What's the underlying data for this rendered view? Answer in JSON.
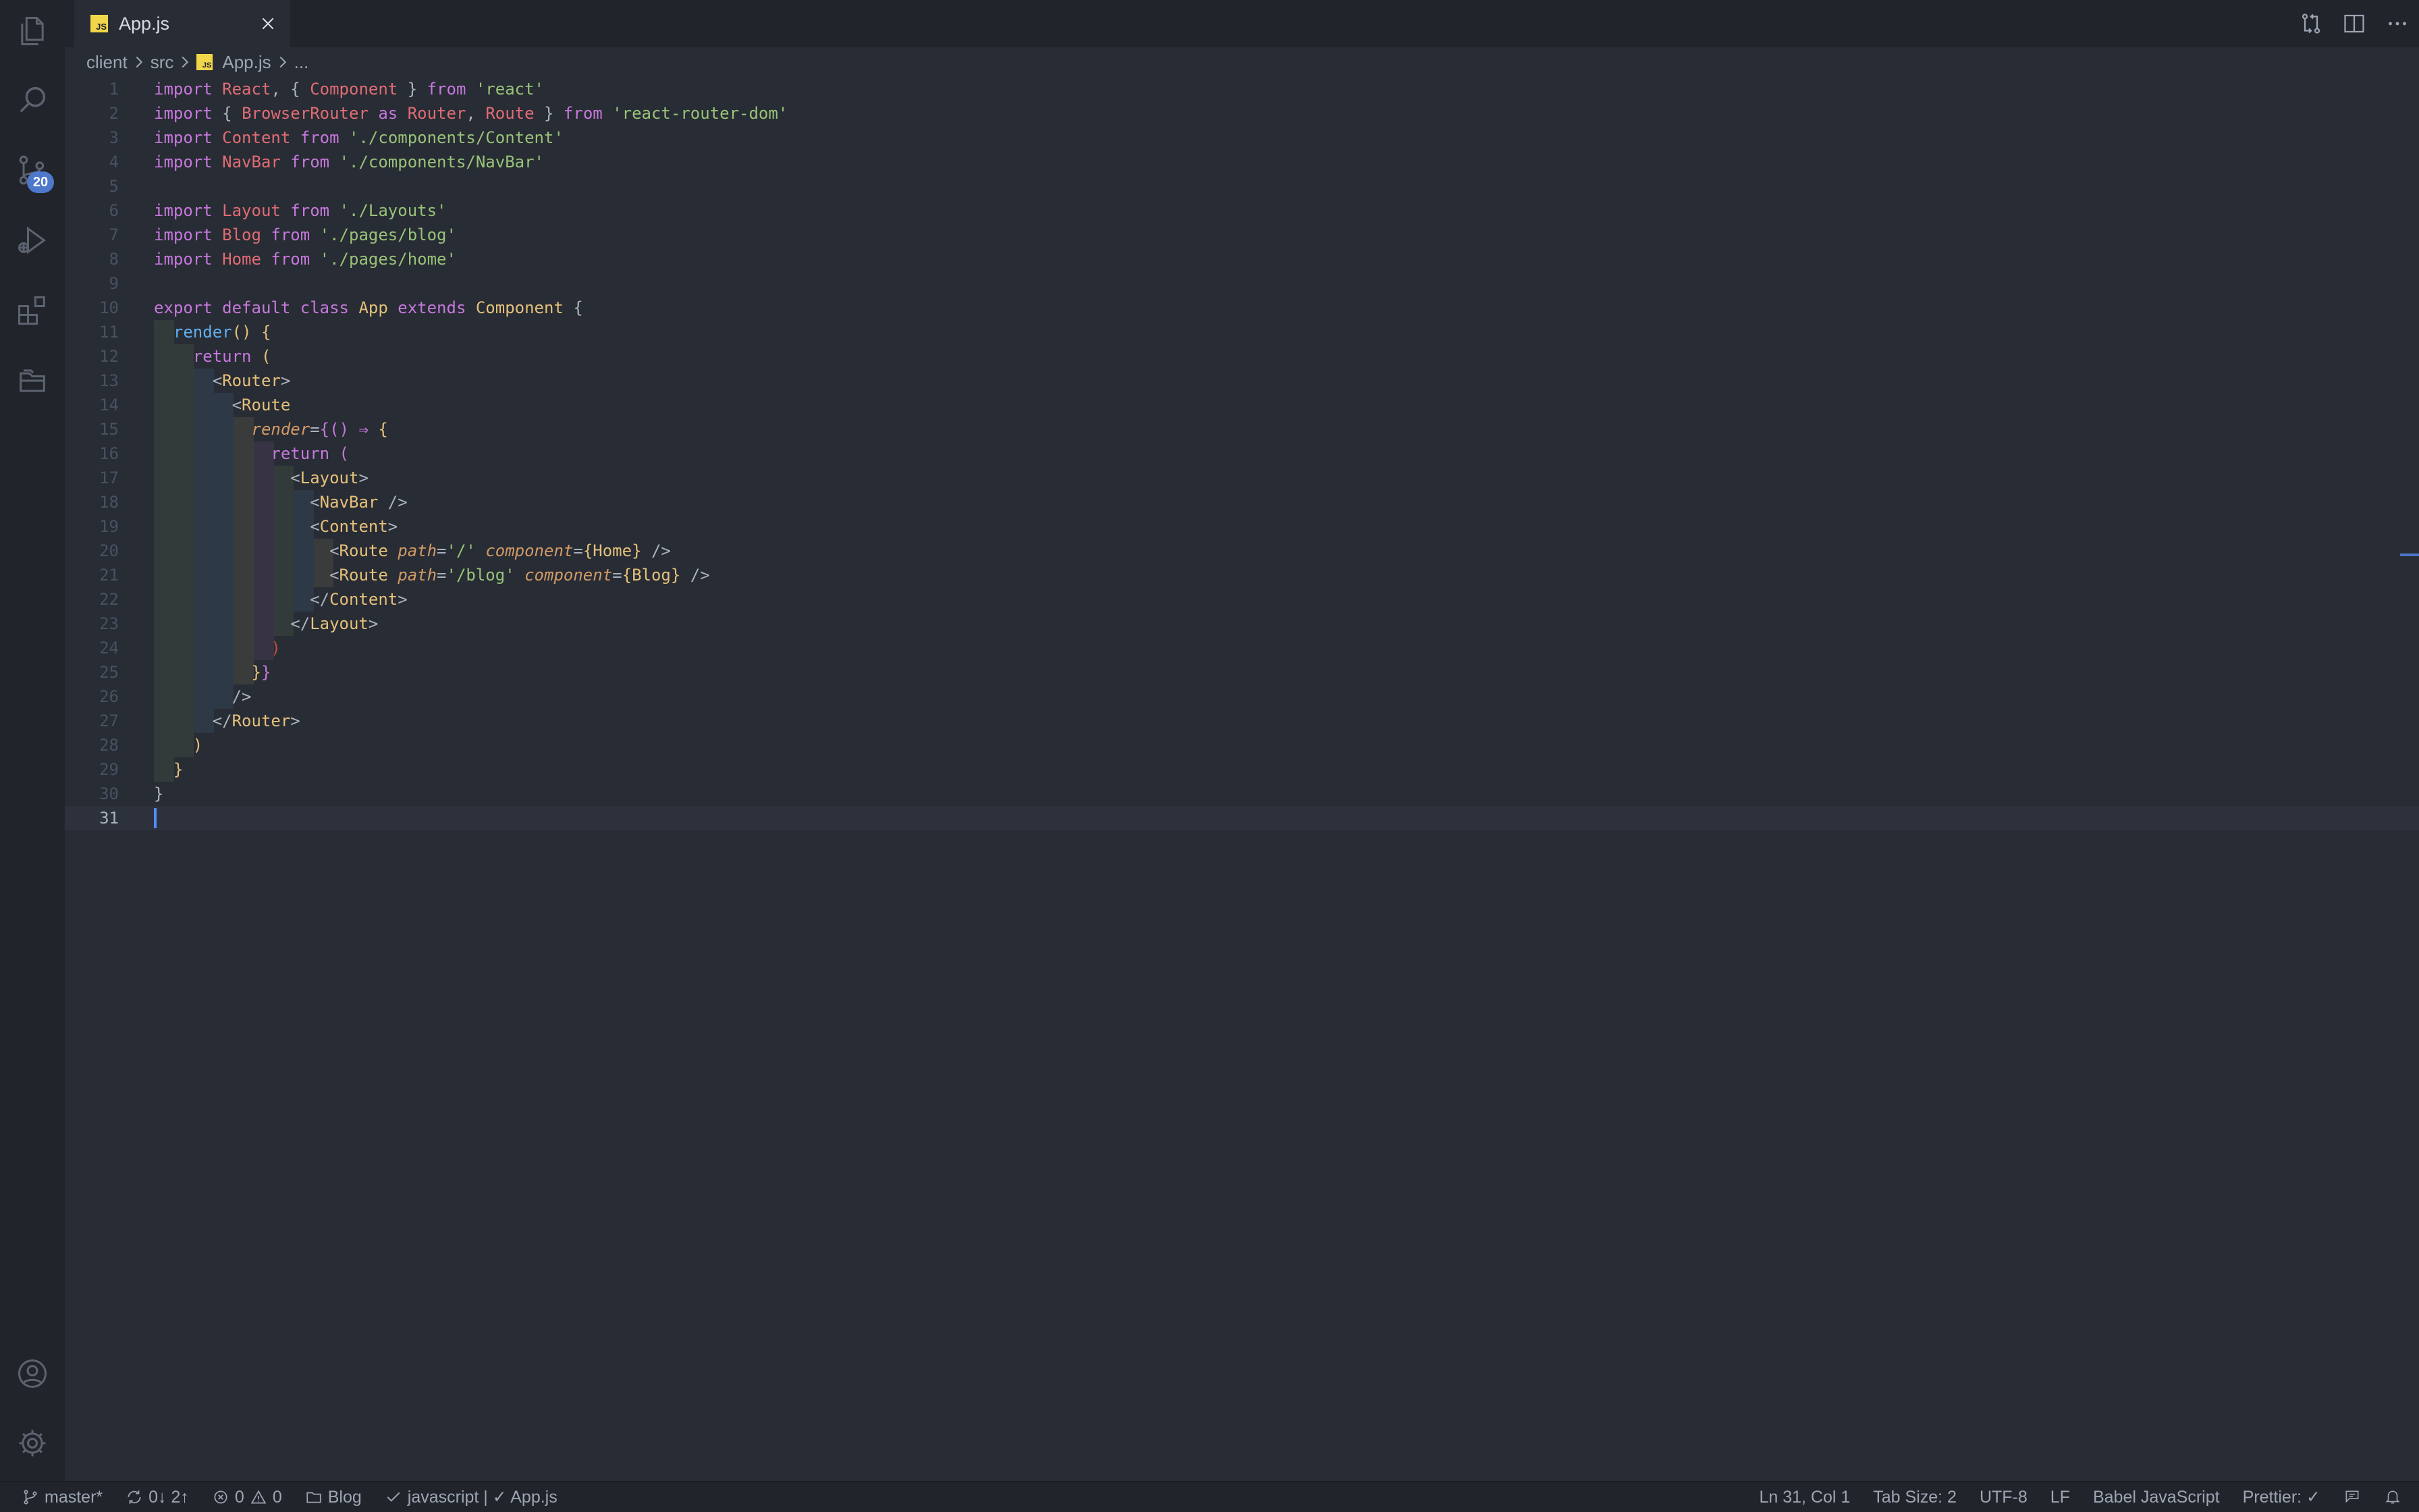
{
  "activity_bar": {
    "items": [
      {
        "name": "explorer",
        "icon": "files-icon"
      },
      {
        "name": "search",
        "icon": "search-icon"
      },
      {
        "name": "source-control",
        "icon": "source-control-icon",
        "badge": "20"
      },
      {
        "name": "run-debug",
        "icon": "run-debug-icon"
      },
      {
        "name": "extensions",
        "icon": "extensions-icon"
      },
      {
        "name": "project-manager",
        "icon": "folders-icon"
      }
    ],
    "bottom": [
      {
        "name": "accounts",
        "icon": "account-icon"
      },
      {
        "name": "manage",
        "icon": "gear-icon"
      }
    ]
  },
  "tabs": [
    {
      "label": "App.js",
      "language_badge": "JS",
      "active": true
    }
  ],
  "editor_actions": [
    "open-changes-icon",
    "split-editor-icon",
    "more-actions-icon"
  ],
  "breadcrumb": {
    "parts": [
      "client",
      "src",
      "App.js",
      "..."
    ]
  },
  "editor": {
    "current_line": 31,
    "lines": [
      "1",
      "2",
      "3",
      "4",
      "5",
      "6",
      "7",
      "8",
      "9",
      "10",
      "11",
      "12",
      "13",
      "14",
      "15",
      "16",
      "17",
      "18",
      "19",
      "20",
      "21",
      "22",
      "23",
      "24",
      "25",
      "26",
      "27",
      "28",
      "29",
      "30",
      "31"
    ],
    "code": [
      [
        [
          "kw",
          "import "
        ],
        [
          "var",
          "React"
        ],
        [
          "punc",
          ", { "
        ],
        [
          "var",
          "Component"
        ],
        [
          "punc",
          " } "
        ],
        [
          "kw",
          "from "
        ],
        [
          "str",
          "'react'"
        ]
      ],
      [
        [
          "kw",
          "import "
        ],
        [
          "punc",
          "{ "
        ],
        [
          "var",
          "BrowserRouter"
        ],
        [
          "kw",
          " as "
        ],
        [
          "var",
          "Router"
        ],
        [
          "punc",
          ", "
        ],
        [
          "var",
          "Route"
        ],
        [
          "punc",
          " } "
        ],
        [
          "kw",
          "from "
        ],
        [
          "str",
          "'react-router-dom'"
        ]
      ],
      [
        [
          "kw",
          "import "
        ],
        [
          "var",
          "Content"
        ],
        [
          "kw",
          " from "
        ],
        [
          "str",
          "'./components/Content'"
        ]
      ],
      [
        [
          "kw",
          "import "
        ],
        [
          "var",
          "NavBar"
        ],
        [
          "kw",
          " from "
        ],
        [
          "str",
          "'./components/NavBar'"
        ]
      ],
      [],
      [
        [
          "kw",
          "import "
        ],
        [
          "var",
          "Layout"
        ],
        [
          "kw",
          " from "
        ],
        [
          "str",
          "'./Layouts'"
        ]
      ],
      [
        [
          "kw",
          "import "
        ],
        [
          "var",
          "Blog"
        ],
        [
          "kw",
          " from "
        ],
        [
          "str",
          "'./pages/blog'"
        ]
      ],
      [
        [
          "kw",
          "import "
        ],
        [
          "var",
          "Home"
        ],
        [
          "kw",
          " from "
        ],
        [
          "str",
          "'./pages/home'"
        ]
      ],
      [],
      [
        [
          "kw",
          "export default class "
        ],
        [
          "cls",
          "App"
        ],
        [
          "kw",
          " extends "
        ],
        [
          "cls",
          "Component"
        ],
        [
          "punc",
          " {"
        ]
      ],
      [
        [
          "punc",
          "  "
        ],
        [
          "fn",
          "render"
        ],
        [
          "b1",
          "()"
        ],
        [
          "punc",
          " "
        ],
        [
          "b1",
          "{"
        ]
      ],
      [
        [
          "punc",
          "    "
        ],
        [
          "kw",
          "return "
        ],
        [
          "b1",
          "("
        ]
      ],
      [
        [
          "punc",
          "      <"
        ],
        [
          "cls",
          "Router"
        ],
        [
          "punc",
          ">"
        ]
      ],
      [
        [
          "punc",
          "        <"
        ],
        [
          "cls",
          "Route"
        ]
      ],
      [
        [
          "punc",
          "          "
        ],
        [
          "attr",
          "render"
        ],
        [
          "punc",
          "="
        ],
        [
          "b2",
          "{"
        ],
        [
          "b2",
          "()"
        ],
        [
          "op",
          " ⇒ "
        ],
        [
          "b1",
          "{"
        ]
      ],
      [
        [
          "punc",
          "            "
        ],
        [
          "kw",
          "return "
        ],
        [
          "b2",
          "("
        ]
      ],
      [
        [
          "punc",
          "              <"
        ],
        [
          "cls",
          "Layout"
        ],
        [
          "punc",
          ">"
        ]
      ],
      [
        [
          "punc",
          "                <"
        ],
        [
          "cls",
          "NavBar"
        ],
        [
          "punc",
          " />"
        ]
      ],
      [
        [
          "punc",
          "                <"
        ],
        [
          "cls",
          "Content"
        ],
        [
          "punc",
          ">"
        ]
      ],
      [
        [
          "punc",
          "                  <"
        ],
        [
          "cls",
          "Route"
        ],
        [
          "punc",
          " "
        ],
        [
          "attr",
          "path"
        ],
        [
          "punc",
          "="
        ],
        [
          "str",
          "'/'"
        ],
        [
          "punc",
          " "
        ],
        [
          "attr",
          "component"
        ],
        [
          "punc",
          "="
        ],
        [
          "b1",
          "{"
        ],
        [
          "cls",
          "Home"
        ],
        [
          "b1",
          "}"
        ],
        [
          "punc",
          " />"
        ]
      ],
      [
        [
          "punc",
          "                  <"
        ],
        [
          "cls",
          "Route"
        ],
        [
          "punc",
          " "
        ],
        [
          "attr",
          "path"
        ],
        [
          "punc",
          "="
        ],
        [
          "str",
          "'/blog'"
        ],
        [
          "punc",
          " "
        ],
        [
          "attr",
          "component"
        ],
        [
          "punc",
          "="
        ],
        [
          "b1",
          "{"
        ],
        [
          "cls",
          "Blog"
        ],
        [
          "b1",
          "}"
        ],
        [
          "punc",
          " />"
        ]
      ],
      [
        [
          "punc",
          "                </"
        ],
        [
          "cls",
          "Content"
        ],
        [
          "punc",
          ">"
        ]
      ],
      [
        [
          "punc",
          "              </"
        ],
        [
          "cls",
          "Layout"
        ],
        [
          "punc",
          ">"
        ]
      ],
      [
        [
          "punc",
          "            "
        ],
        [
          "bad",
          ")"
        ]
      ],
      [
        [
          "punc",
          "          "
        ],
        [
          "b1",
          "}"
        ],
        [
          "b2",
          "}"
        ]
      ],
      [
        [
          "punc",
          "        />"
        ]
      ],
      [
        [
          "punc",
          "      </"
        ],
        [
          "cls",
          "Router"
        ],
        [
          "punc",
          ">"
        ]
      ],
      [
        [
          "punc",
          "    "
        ],
        [
          "b1",
          ")"
        ]
      ],
      [
        [
          "punc",
          "  "
        ],
        [
          "b1",
          "}"
        ]
      ],
      [
        [
          "punc",
          "}"
        ]
      ],
      []
    ]
  },
  "status_bar": {
    "branch": "master*",
    "sync": "0↓ 2↑",
    "errors": "0",
    "warnings": "0",
    "project": "Blog",
    "linter": "javascript | ✓ App.js",
    "cursor_position": "Ln 31, Col 1",
    "tab_size": "Tab Size: 2",
    "encoding": "UTF-8",
    "eol": "LF",
    "language": "Babel JavaScript",
    "formatter": "Prettier: ✓"
  }
}
